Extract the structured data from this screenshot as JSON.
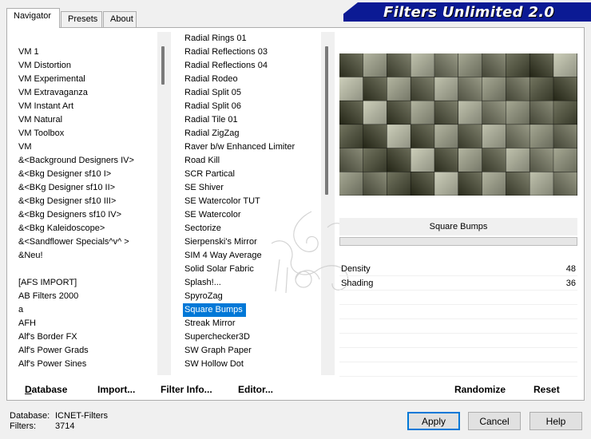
{
  "tabs": [
    "Navigator",
    "Presets",
    "About"
  ],
  "title": "Filters Unlimited 2.0",
  "categories": [
    "VM 1",
    "VM Distortion",
    "VM Experimental",
    "VM Extravaganza",
    "VM Instant Art",
    "VM Natural",
    "VM Toolbox",
    "VM",
    "&<Background Designers IV>",
    "&<Bkg Designer sf10 I>",
    "&<BKg Designer sf10 II>",
    "&<Bkg Designer sf10 III>",
    "&<Bkg Designers sf10 IV>",
    "&<Bkg Kaleidoscope>",
    "&<Sandflower Specials^v^ >",
    "&Neu!",
    "",
    "[AFS IMPORT]",
    "AB Filters 2000",
    "a",
    "AFH",
    "Alf's Border FX",
    "Alf's Power Grads",
    "Alf's Power Sines"
  ],
  "filters": [
    "Radial  Rings 01",
    "Radial Reflections 03",
    "Radial Reflections 04",
    "Radial Rodeo",
    "Radial Split 05",
    "Radial Split 06",
    "Radial Tile 01",
    "Radial ZigZag",
    "Raver b/w Enhanced Limiter",
    "Road Kill",
    "SCR  Partical",
    "SE Shiver",
    "SE Watercolor TUT",
    "SE Watercolor",
    "Sectorize",
    "Sierpenski's Mirror",
    "SIM 4 Way Average",
    "Solid Solar Fabric",
    "Splash!...",
    "SpyroZag",
    "Square Bumps",
    "Streak Mirror",
    "Superchecker3D",
    "SW Graph Paper",
    "SW Hollow Dot"
  ],
  "selected_filter_index": 20,
  "current_filter": "Square Bumps",
  "params": [
    {
      "label": "Density",
      "value": "48"
    },
    {
      "label": "Shading",
      "value": "36"
    },
    {
      "label": "",
      "value": ""
    },
    {
      "label": "",
      "value": ""
    },
    {
      "label": "",
      "value": ""
    },
    {
      "label": "",
      "value": ""
    },
    {
      "label": "",
      "value": ""
    },
    {
      "label": "",
      "value": ""
    }
  ],
  "buttons": {
    "database": "Database",
    "import": "Import...",
    "filter_info": "Filter Info...",
    "editor": "Editor...",
    "randomize": "Randomize",
    "reset": "Reset",
    "apply": "Apply",
    "cancel": "Cancel",
    "help": "Help"
  },
  "status": {
    "database_label": "Database:",
    "database_value": "ICNET-Filters",
    "filters_label": "Filters:",
    "filters_value": "3714"
  },
  "colors": {
    "banner": "#0b1a94",
    "selection": "#0078d7"
  },
  "icons": [
    "watermark-flourish-icon"
  ]
}
